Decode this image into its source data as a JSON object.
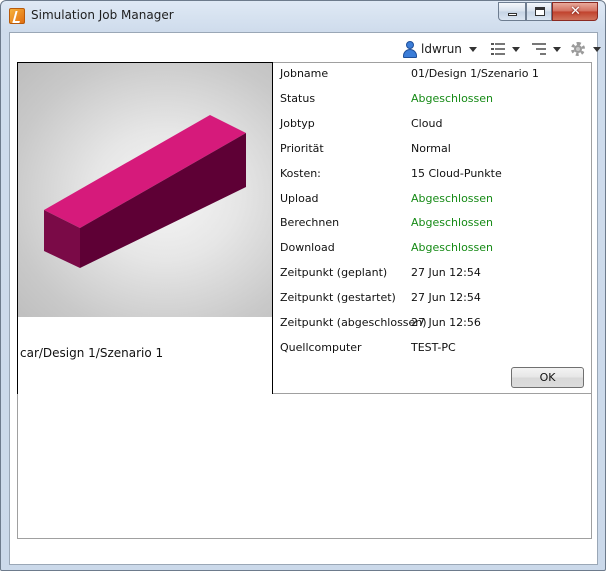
{
  "window": {
    "title": "Simulation Job Manager",
    "close_glyph": "✕"
  },
  "toolbar": {
    "user_label": "ldwrun",
    "icons": [
      "user-icon",
      "list-view-icon",
      "sort-icon",
      "gear-icon"
    ]
  },
  "preview": {
    "caption": "car/Design 1/Szenario 1",
    "shape_color": "#d61a7b"
  },
  "properties": [
    {
      "label": "Jobname",
      "value": "01/Design 1/Szenario 1",
      "status": false
    },
    {
      "label": "Status",
      "value": "Abgeschlossen",
      "status": true
    },
    {
      "label": "Jobtyp",
      "value": "Cloud",
      "status": false
    },
    {
      "label": "Priorität",
      "value": "Normal",
      "status": false
    },
    {
      "label": "Kosten:",
      "value": "15 Cloud-Punkte",
      "status": false
    },
    {
      "label": "Upload",
      "value": "Abgeschlossen",
      "status": true
    },
    {
      "label": "Berechnen",
      "value": "Abgeschlossen",
      "status": true
    },
    {
      "label": "Download",
      "value": "Abgeschlossen",
      "status": true
    },
    {
      "label": "Zeitpunkt (geplant)",
      "value": "27 Jun 12:54",
      "status": false
    },
    {
      "label": "Zeitpunkt (gestartet)",
      "value": "27 Jun 12:54",
      "status": false
    },
    {
      "label": "Zeitpunkt (abgeschlossen)",
      "value": "27 Jun 12:56",
      "status": false
    },
    {
      "label": "Quellcomputer",
      "value": "TEST-PC",
      "status": false
    }
  ],
  "actions": {
    "ok_label": "OK"
  },
  "colors": {
    "status_ok": "#158a15"
  }
}
